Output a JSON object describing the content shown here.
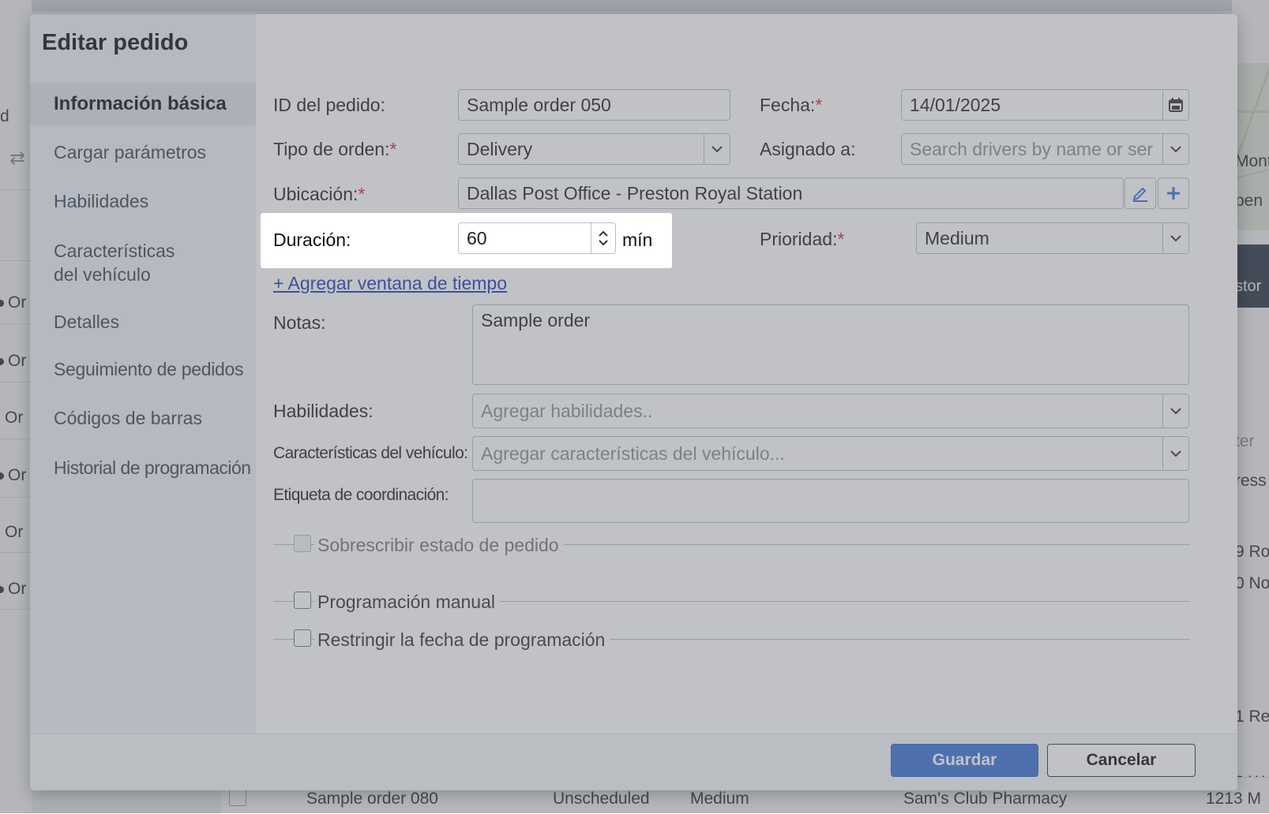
{
  "background": {
    "left_fragments": [
      "d",
      "⇄",
      "Or",
      "Or",
      "Or",
      "Or",
      "Or",
      "Or"
    ],
    "right_fragments": [
      "Mont",
      "pen",
      "stor",
      "ter",
      "ress",
      "9 Ro",
      "0 No",
      "1 Re",
      "0 W"
    ],
    "bottom_row": {
      "order": "Sample order 080",
      "status": "Unscheduled",
      "priority": "Medium",
      "location": "Sam's Club Pharmacy",
      "address": "1213 M"
    }
  },
  "modal": {
    "title": "Editar pedido",
    "sidebar": [
      {
        "label": "Información básica",
        "active": true
      },
      {
        "label": "Cargar parámetros"
      },
      {
        "label": "Habilidades"
      },
      {
        "label_line1": "Características",
        "label_line2": "del vehículo"
      },
      {
        "label": "Detalles"
      },
      {
        "label": "Seguimiento de pedidos"
      },
      {
        "label": "Códigos de barras"
      },
      {
        "label": "Historial de programación"
      }
    ],
    "form": {
      "order_id": {
        "label": "ID del pedido:",
        "value": "Sample order 050"
      },
      "date": {
        "label": "Fecha:",
        "required": "*",
        "value": "14/01/2025"
      },
      "order_type": {
        "label": "Tipo de orden:",
        "required": "*",
        "value": "Delivery"
      },
      "assigned_to": {
        "label": "Asignado a:",
        "placeholder": "Search drivers by name or ser"
      },
      "location": {
        "label": "Ubicación:",
        "required": "*",
        "value": "Dallas Post Office - Preston Royal Station"
      },
      "duration": {
        "label": "Duración:",
        "value": "60",
        "unit": "mín"
      },
      "priority": {
        "label": "Prioridad:",
        "required": "*",
        "value": "Medium"
      },
      "add_time_window": "+ Agregar ventana de tiempo",
      "notes": {
        "label": "Notas:",
        "value": "Sample order"
      },
      "skills": {
        "label": "Habilidades:",
        "placeholder": "Agregar habilidades.."
      },
      "vehicle_features": {
        "label": "Características del vehículo:",
        "placeholder": "Agregar características del vehículo..."
      },
      "coordination_tag": {
        "label": "Etiqueta de coordinación:",
        "value": ""
      },
      "override_status": {
        "label": "Sobrescribir estado de pedido",
        "checked": false
      },
      "manual_scheduling": {
        "label": "Programación manual",
        "checked": false
      },
      "restrict_date": {
        "label": "Restringir la fecha de programación",
        "checked": false
      }
    },
    "footer": {
      "save": "Guardar",
      "cancel": "Cancelar"
    }
  },
  "colors": {
    "primary": "#3b73d8",
    "link": "#1a3fb0",
    "required": "#d62828"
  },
  "icons": [
    "calendar-icon",
    "chevron-down-icon",
    "pencil-icon",
    "plus-icon",
    "chevron-up-icon",
    "swap-icon"
  ]
}
